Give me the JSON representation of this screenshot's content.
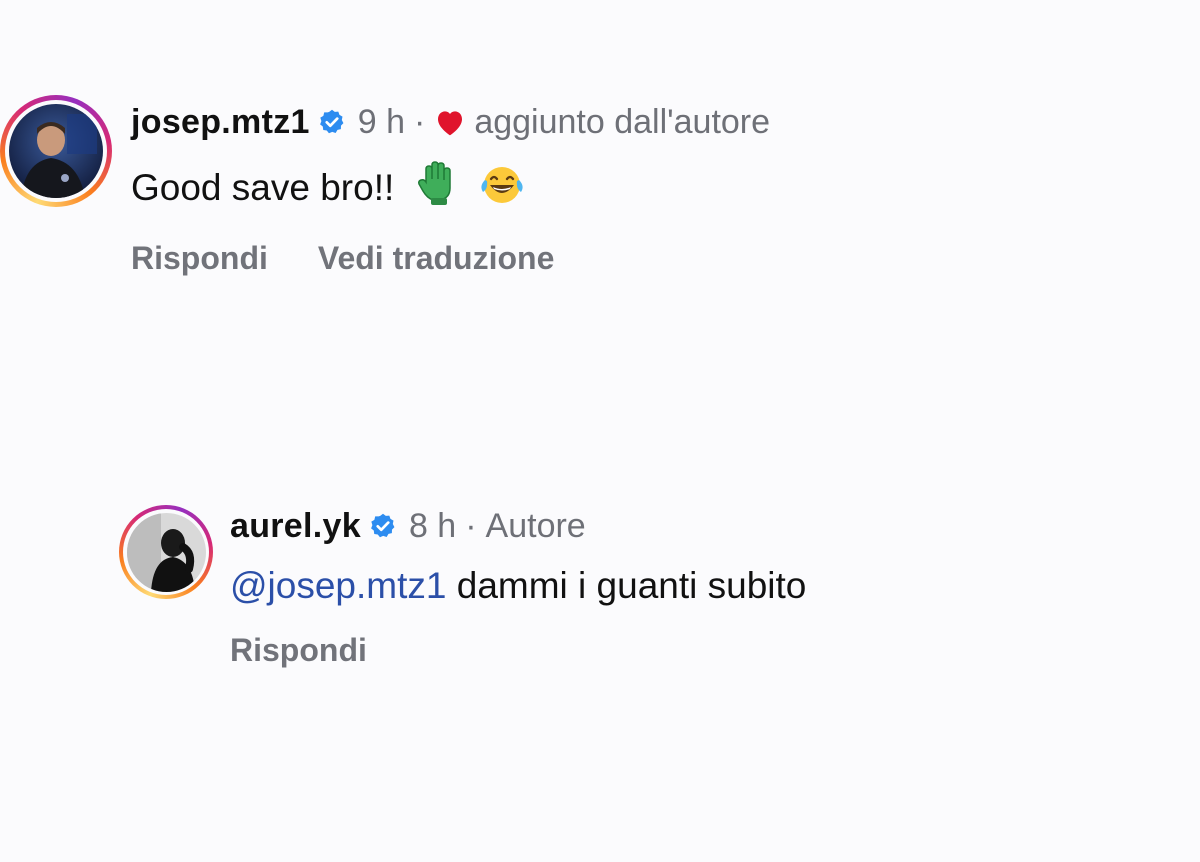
{
  "comments": [
    {
      "username": "josep.mtz1",
      "time": "9 h",
      "separator": "·",
      "note": "aggiunto dall'autore",
      "text": "Good save bro!!",
      "emojis": [
        "glove-emoji",
        "laughing-tears-emoji"
      ],
      "actions": {
        "reply": "Rispondi",
        "translate": "Vedi traduzione"
      },
      "colors": {
        "heart": "#e0142c",
        "verified": "#2d8cf0"
      }
    },
    {
      "username": "aurel.yk",
      "time": "8 h",
      "separator": "·",
      "note": "Autore",
      "mention": "@josep.mtz1",
      "text": " dammi i guanti subito",
      "actions": {
        "reply": "Rispondi"
      }
    }
  ],
  "colors": {
    "background": "#fbfbfd",
    "mention": "#2b4fa8",
    "secondary_text": "#6e7077"
  }
}
